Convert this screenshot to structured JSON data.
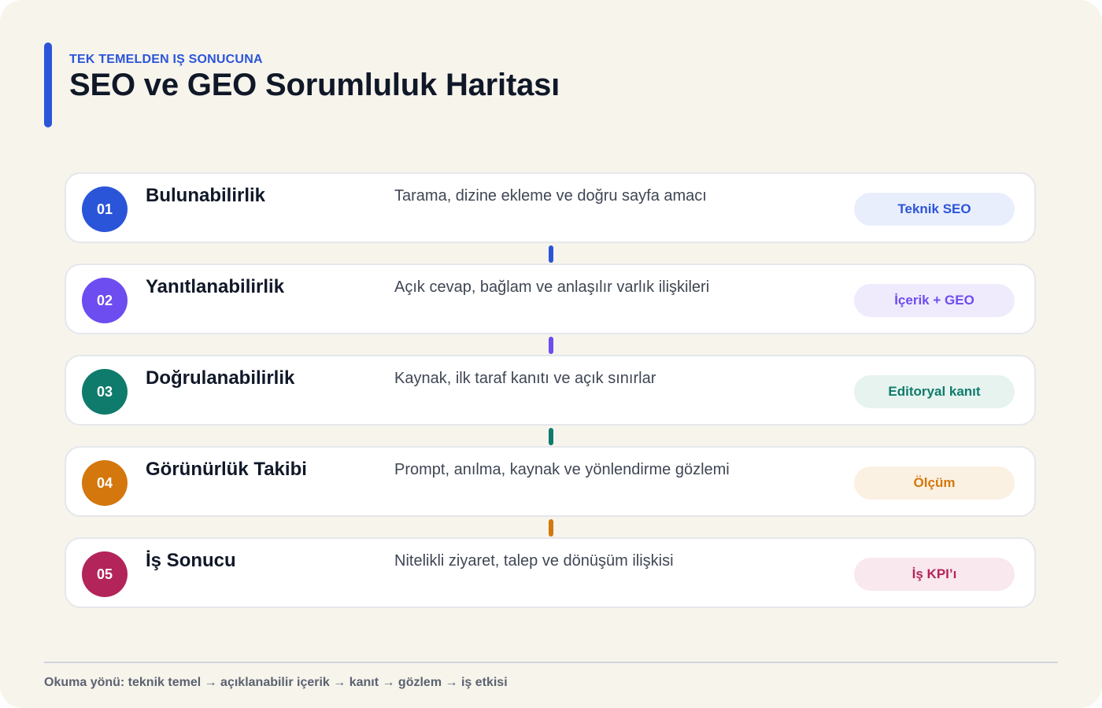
{
  "header": {
    "eyebrow": "TEK TEMELDEN IŞ SONUCUNA",
    "title": "SEO ve GEO Sorumluluk Haritası"
  },
  "steps": [
    {
      "number": "01",
      "title": "Bulunabilirlik",
      "description": "Tarama, dizine ekleme ve doğru sayfa amacı",
      "tag": "Teknik SEO",
      "color": "#2b55d9",
      "tag_bg": "#e9eefc"
    },
    {
      "number": "02",
      "title": "Yanıtlanabilirlik",
      "description": "Açık cevap, bağlam ve anlaşılır varlık ilişkileri",
      "tag": "İçerik + GEO",
      "color": "#6d4cf0",
      "tag_bg": "#efebfd"
    },
    {
      "number": "03",
      "title": "Doğrulanabilirlik",
      "description": "Kaynak, ilk taraf kanıtı ve açık sınırlar",
      "tag": "Editoryal kanıt",
      "color": "#0f7b6c",
      "tag_bg": "#e6f3ef"
    },
    {
      "number": "04",
      "title": "Görünürlük Takibi",
      "description": "Prompt, anılma, kaynak ve yönlendirme gözlemi",
      "tag": "Ölçüm",
      "color": "#d4770c",
      "tag_bg": "#fbf1e2"
    },
    {
      "number": "05",
      "title": "İş Sonucu",
      "description": "Nitelikli ziyaret, talep ve dönüşüm ilişkisi",
      "tag": "İş KPI’ı",
      "color": "#b3245a",
      "tag_bg": "#f9e8ee"
    }
  ],
  "footer": {
    "note": "Okuma yönü: teknik temel → açıklanabilir içerik → kanıt → gözlem → iş etkisi"
  }
}
